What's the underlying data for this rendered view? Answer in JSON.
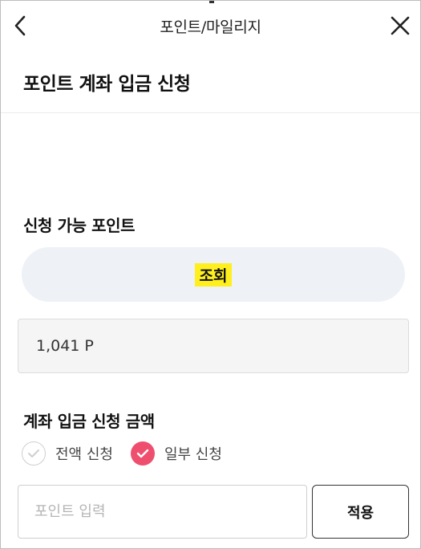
{
  "header": {
    "title": "포인트/마일리지",
    "back_icon": "chevron-left-icon",
    "close_icon": "close-icon"
  },
  "page": {
    "title": "포인트 계좌 입금 신청"
  },
  "available": {
    "label": "신청 가능 포인트",
    "lookup_label": "조회",
    "points_value": "1,041 P"
  },
  "request": {
    "label": "계좌 입금 신청 금액",
    "options": [
      {
        "label": "전액 신청",
        "selected": false
      },
      {
        "label": "일부 신청",
        "selected": true
      }
    ],
    "input_placeholder": "포인트 입력",
    "apply_label": "적용"
  },
  "colors": {
    "accent": "#ef4f6e",
    "highlight": "#ffef1f",
    "lookup_bg": "#eef1f5"
  }
}
